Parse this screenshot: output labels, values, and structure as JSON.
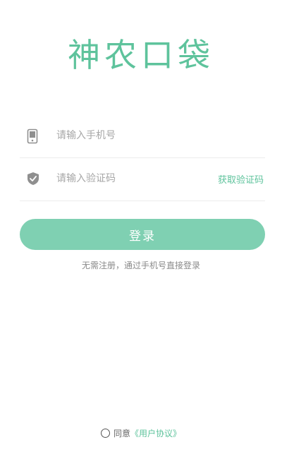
{
  "app": {
    "logo_text": "神农口袋"
  },
  "form": {
    "phone_placeholder": "请输入手机号",
    "code_placeholder": "请输入验证码",
    "get_code_label": "获取验证码",
    "login_label": "登录",
    "hint_text": "无需注册，通过手机号直接登录"
  },
  "agreement": {
    "agree_text": "同意",
    "link_text": "《用户协议》"
  },
  "colors": {
    "accent": "#5ec39c",
    "button": "#7fd0b2"
  },
  "icons": {
    "phone": "phone-icon",
    "shield": "shield-icon"
  }
}
